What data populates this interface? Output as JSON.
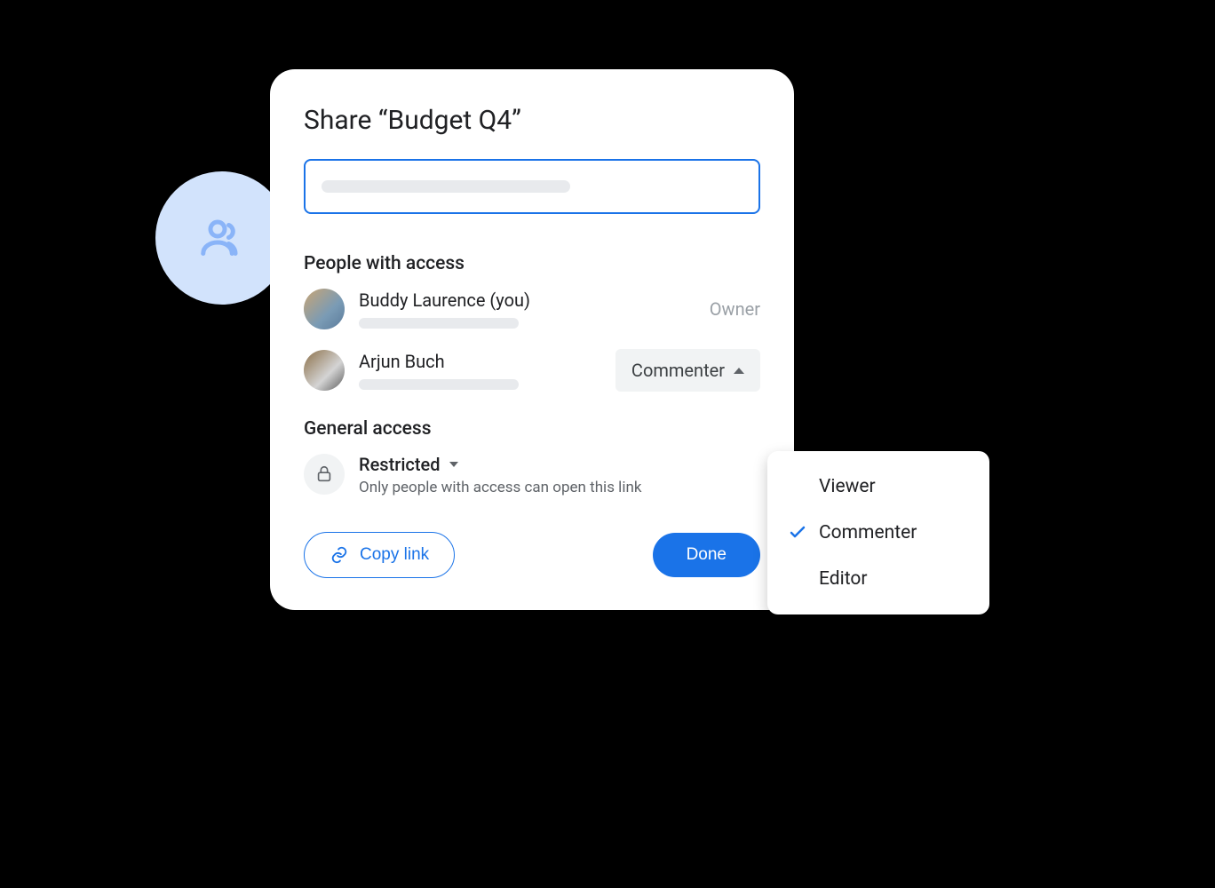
{
  "dialog": {
    "title": "Share “Budget Q4”",
    "people_heading": "People with access",
    "people": [
      {
        "name": "Buddy Laurence (you)",
        "role": "Owner"
      },
      {
        "name": "Arjun Buch",
        "role": "Commenter"
      }
    ],
    "general": {
      "heading": "General access",
      "label": "Restricted",
      "description": "Only people with access can open this link"
    },
    "copy_link_label": "Copy link",
    "done_label": "Done"
  },
  "popover": {
    "options": [
      {
        "label": "Viewer",
        "checked": false
      },
      {
        "label": "Commenter",
        "checked": true
      },
      {
        "label": "Editor",
        "checked": false
      }
    ]
  }
}
